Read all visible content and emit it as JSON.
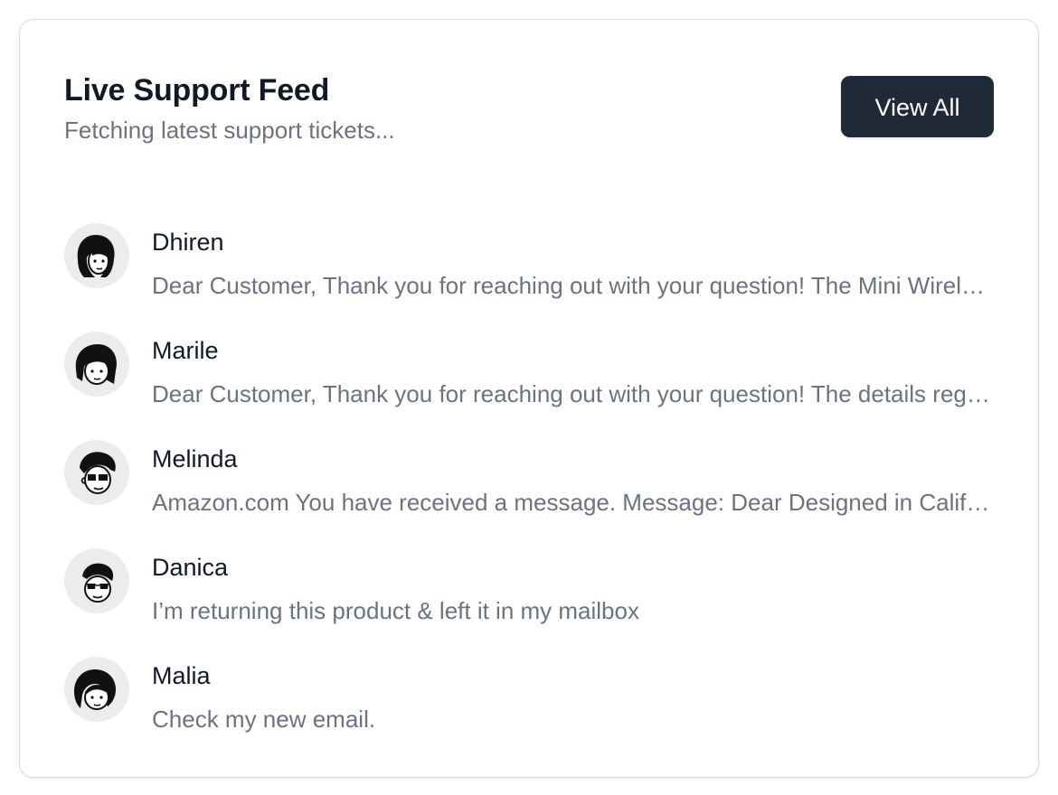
{
  "header": {
    "title": "Live Support Feed",
    "subtitle": "Fetching latest support tickets..."
  },
  "actions": {
    "view_all_label": "View All"
  },
  "tickets": [
    {
      "name": "Dhiren",
      "message": "Dear Customer, Thank you for reaching out with your question! The Mini Wireless Earbuds you purchased are",
      "avatar_icon": "person-avatar-icon"
    },
    {
      "name": "Marile",
      "message": "Dear Customer, Thank you for reaching out with your question! The details regarding your order are",
      "avatar_icon": "person-avatar-icon"
    },
    {
      "name": "Melinda",
      "message": "Amazon.com You have received a message. Message: Dear Designed in California team",
      "avatar_icon": "person-avatar-icon"
    },
    {
      "name": "Danica",
      "message": "I’m returning this product & left it in my mailbox",
      "avatar_icon": "person-avatar-icon"
    },
    {
      "name": "Malia",
      "message": "Check my new email.",
      "avatar_icon": "person-avatar-icon"
    }
  ],
  "colors": {
    "button_bg": "#1f2937",
    "title_text": "#111827",
    "muted_text": "#6b7280",
    "avatar_bg": "#ececec"
  }
}
